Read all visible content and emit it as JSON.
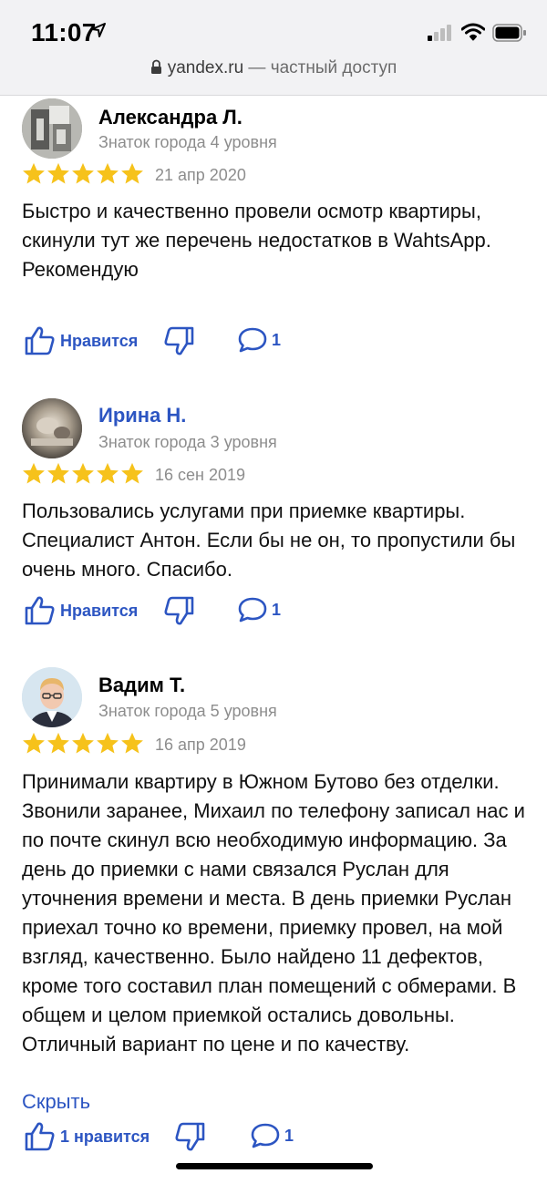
{
  "status_bar": {
    "time": "11:07",
    "url_domain": "yandex.ru",
    "url_suffix": " — частный доступ"
  },
  "colors": {
    "accent": "#2c55c2",
    "star": "#f6c21b",
    "muted": "#8d8d8d"
  },
  "reviews": [
    {
      "author": "Александра Л.",
      "level": "Знаток города 4 уровня",
      "rating": 5,
      "date": "21 апр 2020",
      "text": [
        "Быстро и качественно провели осмотр квартиры, скинули тут же перечень недостатков в WahtsApp.",
        "Рекомендую"
      ],
      "like_label": "Нравится",
      "comments": "1"
    },
    {
      "author": "Ирина Н.",
      "level": "Знаток города 3 уровня",
      "rating": 5,
      "date": "16 сен 2019",
      "text": [
        "Пользовались услугами при приемке квартиры. Специалист Антон. Если бы не он, то пропустили бы очень много. Спасибо."
      ],
      "like_label": "Нравится",
      "comments": "1"
    },
    {
      "author": "Вадим Т.",
      "level": "Знаток города 5 уровня",
      "rating": 5,
      "date": "16 апр 2019",
      "text": [
        "Принимали квартиру в Южном Бутово без отделки. Звонили заранее, Михаил по телефону записал нас и по почте скинул всю необходимую информацию. За день до приемки с нами связался Руслан для уточнения времени и места. В день приемки Руслан приехал точно ко времени, приемку провел, на мой взгляд, качественно. Было найдено 11 дефектов, кроме того составил план помещений с обмерами. В общем и целом приемкой остались довольны. Отличный вариант по цене и по качеству."
      ],
      "hide_label": "Скрыть",
      "like_label": "1 нравится",
      "comments": "1"
    }
  ]
}
